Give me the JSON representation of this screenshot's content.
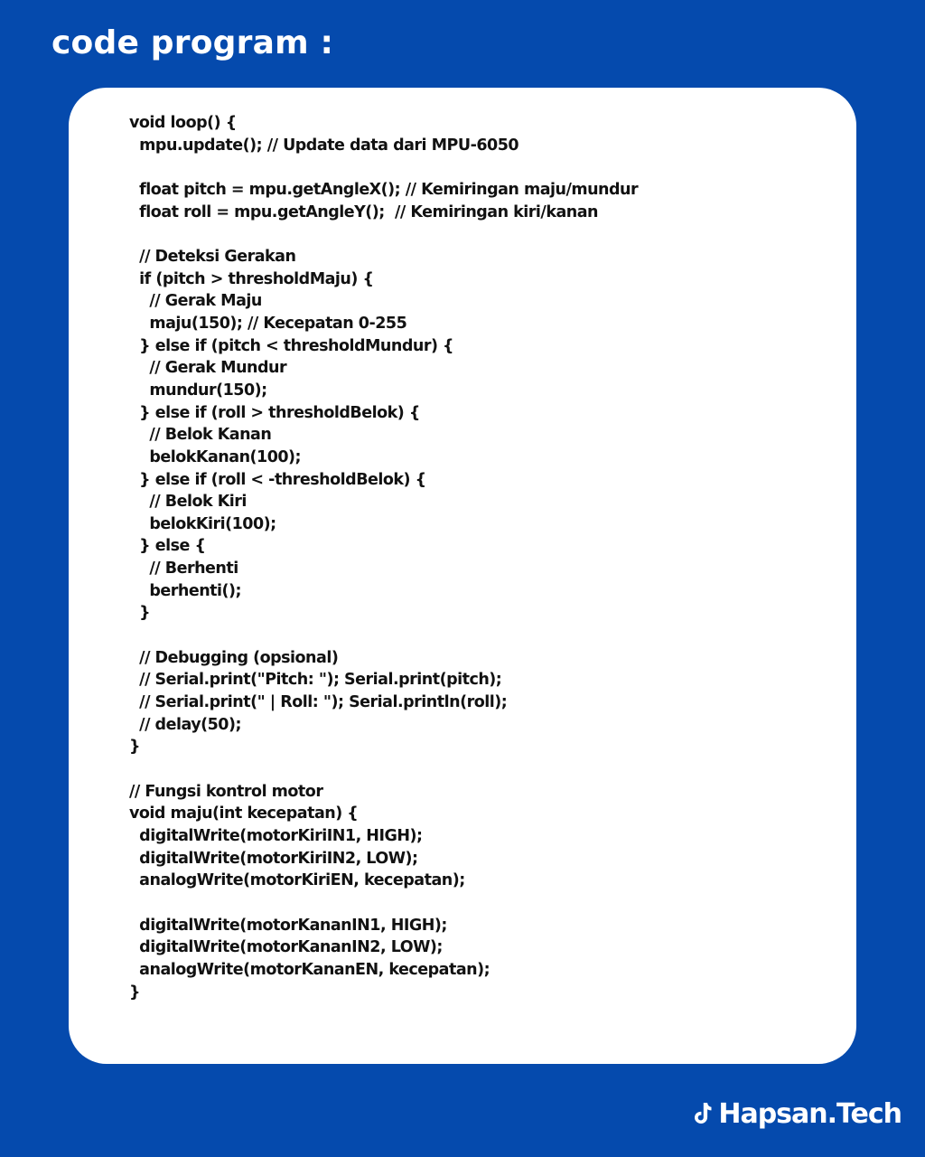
{
  "page_title": "code program :",
  "code_lines": [
    "void loop() {",
    "  mpu.update(); // Update data dari MPU-6050",
    "",
    "  float pitch = mpu.getAngleX(); // Kemiringan maju/mundur",
    "  float roll = mpu.getAngleY();  // Kemiringan kiri/kanan",
    "",
    "  // Deteksi Gerakan",
    "  if (pitch > thresholdMaju) {",
    "    // Gerak Maju",
    "    maju(150); // Kecepatan 0-255",
    "  } else if (pitch < thresholdMundur) {",
    "    // Gerak Mundur",
    "    mundur(150);",
    "  } else if (roll > thresholdBelok) {",
    "    // Belok Kanan",
    "    belokKanan(100);",
    "  } else if (roll < -thresholdBelok) {",
    "    // Belok Kiri",
    "    belokKiri(100);",
    "  } else {",
    "    // Berhenti",
    "    berhenti();",
    "  }",
    "",
    "  // Debugging (opsional)",
    "  // Serial.print(\"Pitch: \"); Serial.print(pitch);",
    "  // Serial.print(\" | Roll: \"); Serial.println(roll);",
    "  // delay(50);",
    "}",
    "",
    "// Fungsi kontrol motor",
    "void maju(int kecepatan) {",
    "  digitalWrite(motorKiriIN1, HIGH);",
    "  digitalWrite(motorKiriIN2, LOW);",
    "  analogWrite(motorKiriEN, kecepatan);",
    "",
    "  digitalWrite(motorKananIN1, HIGH);",
    "  digitalWrite(motorKananIN2, LOW);",
    "  analogWrite(motorKananEN, kecepatan);",
    "}"
  ],
  "watermark": {
    "icon": "tiktok-icon",
    "text": "Hapsan.Tech"
  },
  "colors": {
    "background": "#054aad",
    "card": "#ffffff",
    "code_text": "#111111",
    "title_text": "#ffffff"
  }
}
